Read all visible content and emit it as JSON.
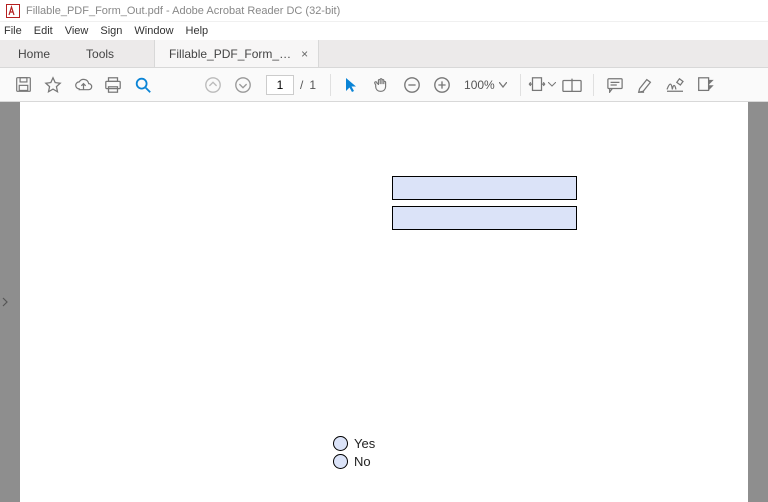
{
  "titlebar": {
    "title": "Fillable_PDF_Form_Out.pdf - Adobe Acrobat Reader DC (32-bit)"
  },
  "menubar": {
    "items": [
      "File",
      "Edit",
      "View",
      "Sign",
      "Window",
      "Help"
    ]
  },
  "tabsbar": {
    "home": "Home",
    "tools": "Tools",
    "doc": "Fillable_PDF_Form_…",
    "close": "×"
  },
  "toolbar": {
    "page_current": "1",
    "page_sep": "/",
    "page_total": "1",
    "zoom_label": "100%"
  },
  "form": {
    "radio_yes": "Yes",
    "radio_no": "No"
  }
}
